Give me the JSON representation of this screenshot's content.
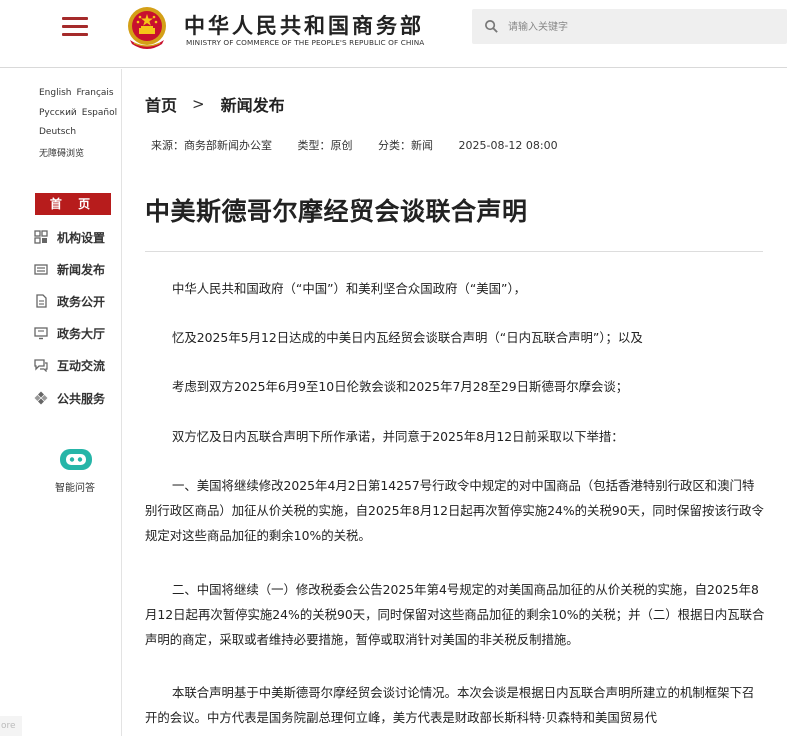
{
  "header": {
    "site_title": "中华人民共和国商务部",
    "site_subtitle": "MINISTRY OF COMMERCE OF THE PEOPLE'S REPUBLIC OF CHINA",
    "search_placeholder": "请输入关键字",
    "accent_color": "#a52a2a"
  },
  "sidebar": {
    "languages_row1": [
      "English",
      "Français"
    ],
    "languages_row2": [
      "Русский",
      "Español"
    ],
    "languages_row3": [
      "Deutsch"
    ],
    "accessibility": "无障碍浏览",
    "home_label": "首 页",
    "nav": [
      {
        "label": "机构设置",
        "icon": "org-icon"
      },
      {
        "label": "新闻发布",
        "icon": "news-icon"
      },
      {
        "label": "政务公开",
        "icon": "document-icon"
      },
      {
        "label": "政务大厅",
        "icon": "monitor-icon"
      },
      {
        "label": "互动交流",
        "icon": "chat-icon"
      },
      {
        "label": "公共服务",
        "icon": "service-icon"
      }
    ],
    "assistant_label": "智能问答",
    "edge_tab": "ore"
  },
  "breadcrumb": {
    "home": "首页",
    "separator": ">",
    "current": "新闻发布"
  },
  "meta": {
    "source": "来源：商务部新闻办公室",
    "type": "类型：原创",
    "category": "分类：新闻",
    "datetime": "2025-08-12 08:00"
  },
  "article": {
    "title": "中美斯德哥尔摩经贸会谈联合声明",
    "paragraphs": [
      "中华人民共和国政府（“中国”）和美利坚合众国政府（“美国”），",
      "忆及2025年5月12日达成的中美日内瓦经贸会谈联合声明（“日内瓦联合声明”）；以及",
      "考虑到双方2025年6月9至10日伦敦会谈和2025年7月28至29日斯德哥尔摩会谈；",
      "双方忆及日内瓦联合声明下所作承诺，并同意于2025年8月12日前采取以下举措：",
      "一、美国将继续修改2025年4月2日第14257号行政令中规定的对中国商品（包括香港特别行政区和澳门特别行政区商品）加征从价关税的实施，自2025年8月12日起再次暂停实施24%的关税90天，同时保留按该行政令规定对这些商品加征的剩余10%的关税。",
      "二、中国将继续（一）修改税委会公告2025年第4号规定的对美国商品加征的从价关税的实施，自2025年8月12日起再次暂停实施24%的关税90天，同时保留对这些商品加征的剩余10%的关税；并（二）根据日内瓦联合声明的商定，采取或者维持必要措施，暂停或取消针对美国的非关税反制措施。",
      "本联合声明基于中美斯德哥尔摩经贸会谈讨论情况。本次会谈是根据日内瓦联合声明所建立的机制框架下召开的会议。中方代表是国务院副总理何立峰，美方代表是财政部长斯科特·贝森特和美国贸易代"
    ]
  }
}
